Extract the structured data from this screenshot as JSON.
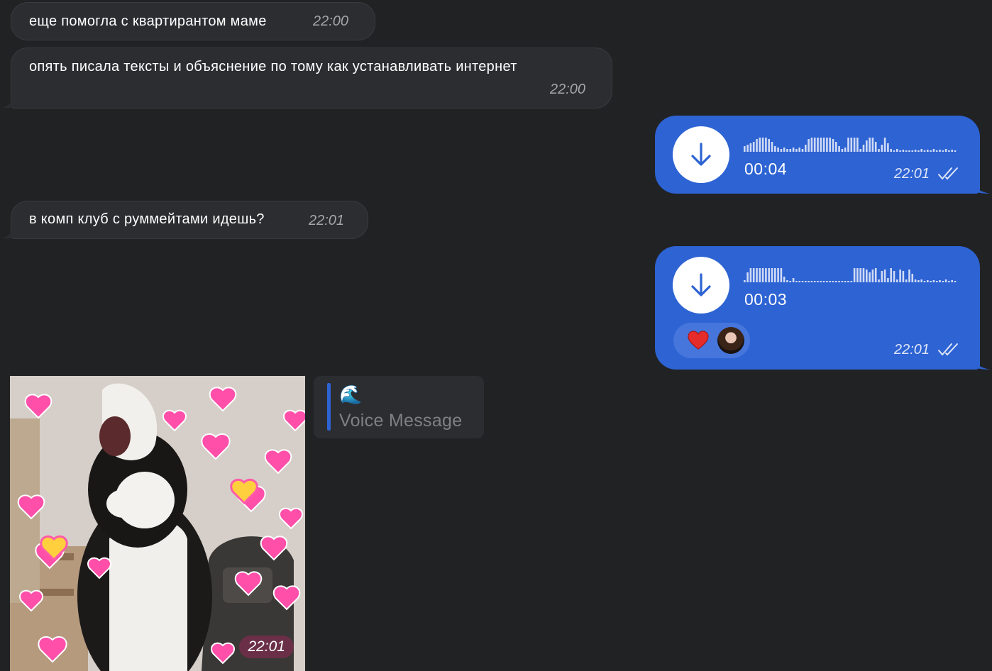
{
  "messages": [
    {
      "text": "еще помогла с квартирантом маме",
      "time": "22:00"
    },
    {
      "text": "опять писала тексты и объяснение по тому как устанавливать интернет",
      "time": "22:00"
    },
    {
      "duration": "00:04",
      "time": "22:01"
    },
    {
      "text": "в комп клуб с руммейтами идешь?",
      "time": "22:01"
    },
    {
      "duration": "00:03",
      "time": "22:01",
      "reaction": "red-heart"
    },
    {
      "sticker_time": "22:01"
    }
  ],
  "reply": {
    "emoji": "🌊",
    "label": "Voice Message"
  },
  "colors": {
    "background": "#212224",
    "incoming": "#2c2d30",
    "outgoing": "#2d63d3"
  }
}
